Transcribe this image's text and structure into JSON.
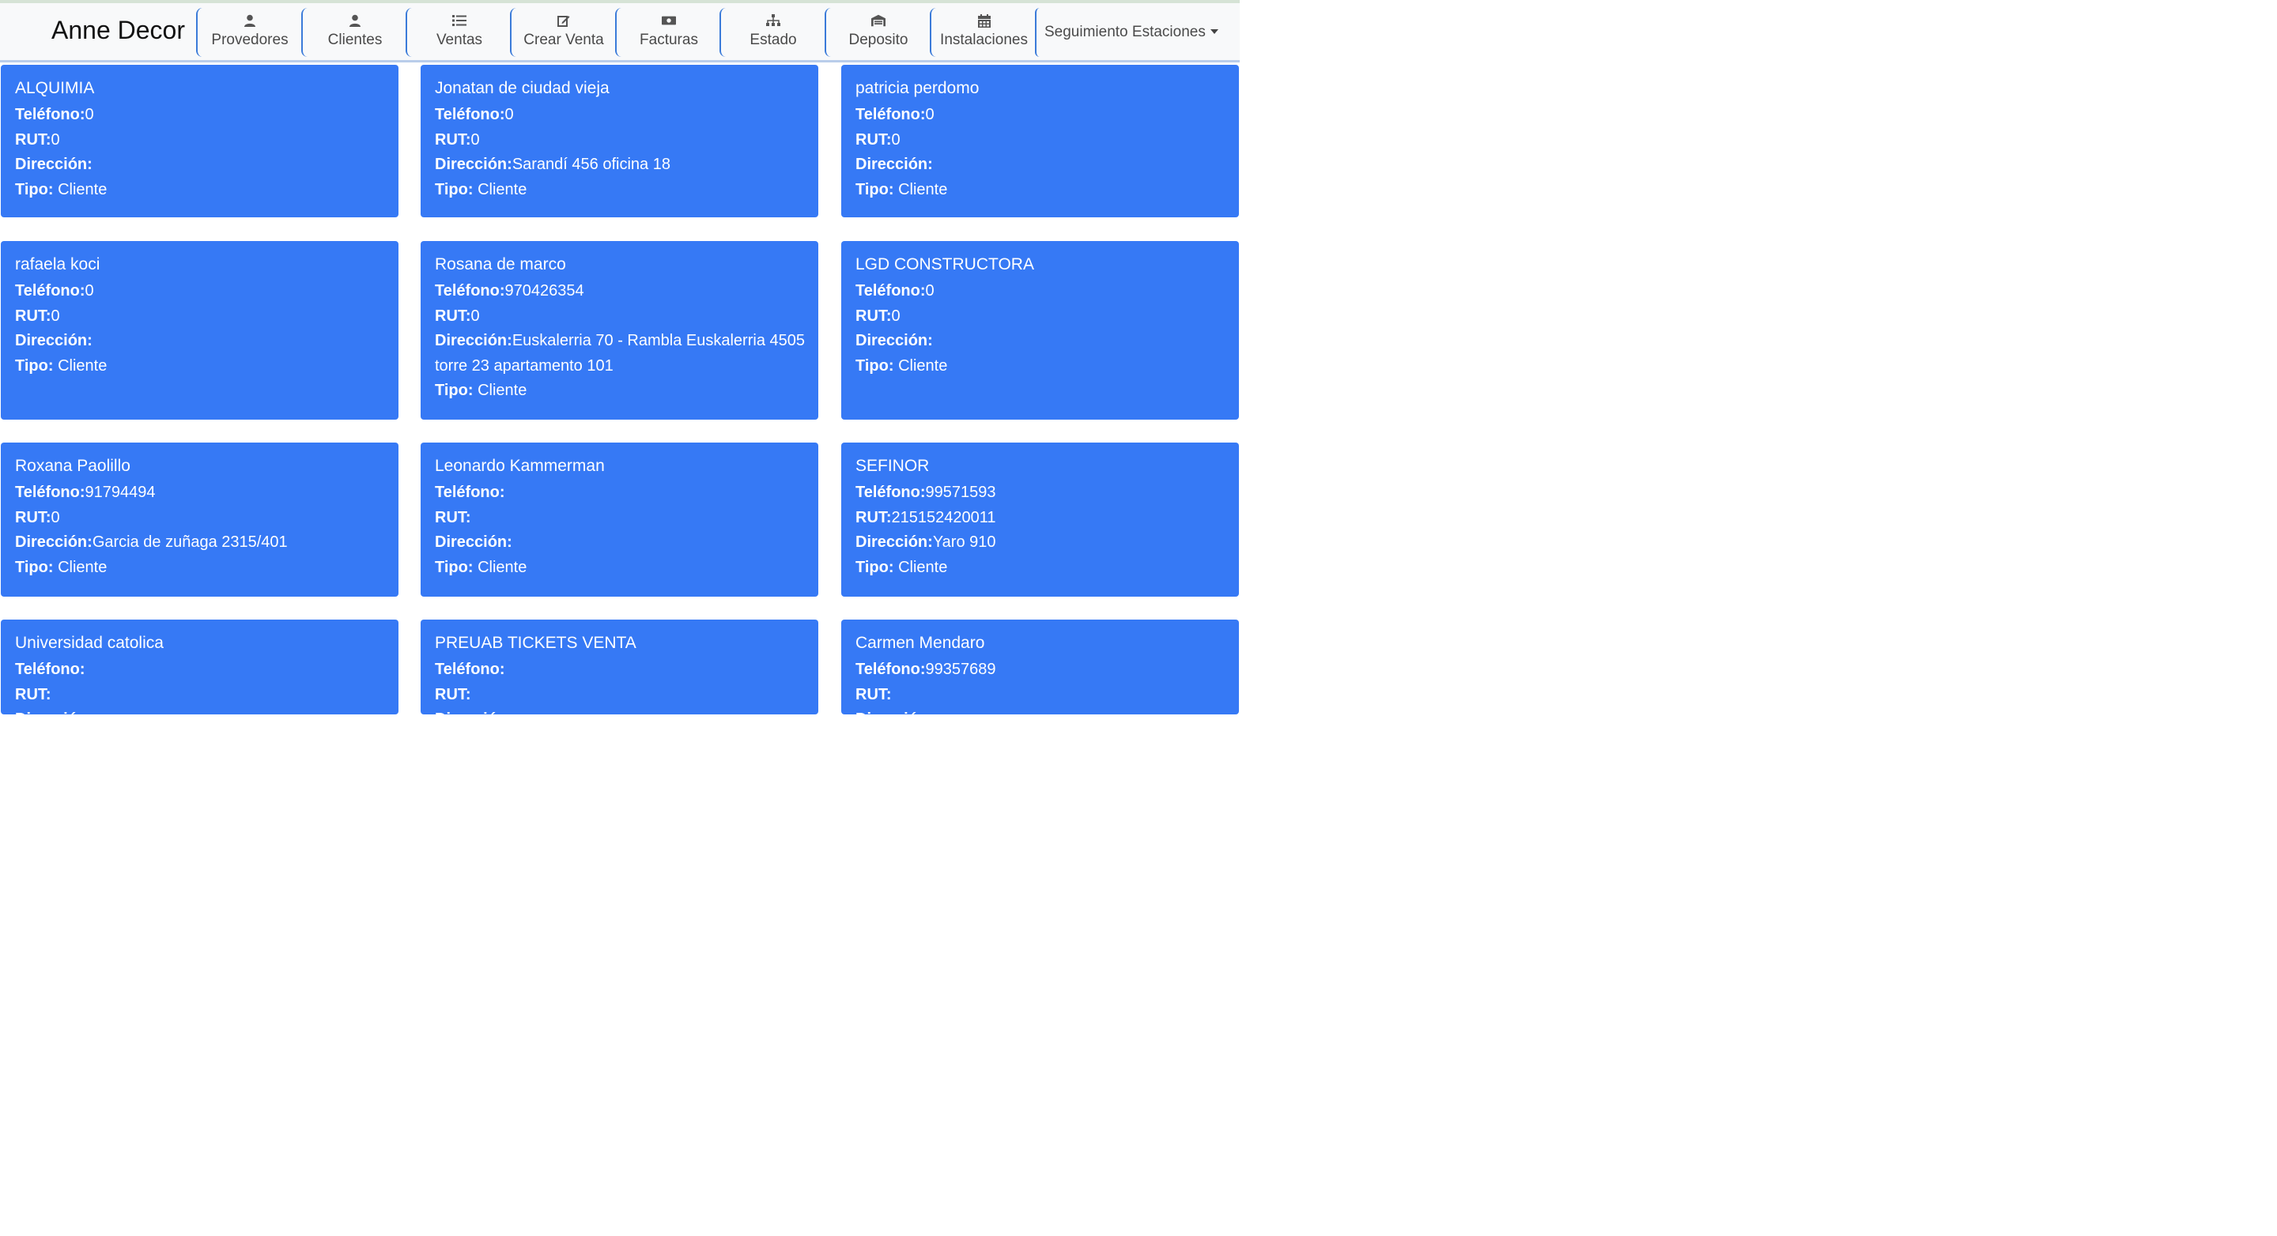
{
  "app": {
    "brand": "Anne Decor"
  },
  "nav": {
    "items": [
      {
        "label": "Provedores",
        "icon": "user-icon"
      },
      {
        "label": "Clientes",
        "icon": "user-icon"
      },
      {
        "label": "Ventas",
        "icon": "list-icon"
      },
      {
        "label": "Crear Venta",
        "icon": "edit-icon"
      },
      {
        "label": "Facturas",
        "icon": "money-bill-icon"
      },
      {
        "label": "Estado",
        "icon": "sitemap-icon"
      },
      {
        "label": "Deposito",
        "icon": "warehouse-icon"
      },
      {
        "label": "Instalaciones",
        "icon": "calendar-icon"
      }
    ],
    "dropdown": {
      "label": "Seguimiento Estaciones"
    }
  },
  "field_labels": {
    "telefono": "Teléfono:",
    "rut": "RUT:",
    "direccion": "Dirección:",
    "tipo": "Tipo:"
  },
  "cards": [
    {
      "name": "ALQUIMIA",
      "telefono": "0",
      "rut": "0",
      "direccion": "",
      "tipo": "Cliente"
    },
    {
      "name": "Jonatan de ciudad vieja",
      "telefono": "0",
      "rut": "0",
      "direccion": "Sarandí 456 oficina 18",
      "tipo": "Cliente"
    },
    {
      "name": "patricia perdomo",
      "telefono": "0",
      "rut": "0",
      "direccion": "",
      "tipo": "Cliente"
    },
    {
      "name": "rafaela koci",
      "telefono": "0",
      "rut": "0",
      "direccion": "",
      "tipo": "Cliente"
    },
    {
      "name": "Rosana de marco",
      "telefono": "970426354",
      "rut": "0",
      "direccion": "Euskalerria 70 - Rambla Euskalerria 4505 torre 23 apartamento 101",
      "tipo": "Cliente"
    },
    {
      "name": "LGD CONSTRUCTORA",
      "telefono": "0",
      "rut": "0",
      "direccion": "",
      "tipo": "Cliente"
    },
    {
      "name": "Roxana Paolillo",
      "telefono": "91794494",
      "rut": "0",
      "direccion": "Garcia de zuñaga 2315/401",
      "tipo": "Cliente"
    },
    {
      "name": "Leonardo Kammerman",
      "telefono": "",
      "rut": "",
      "direccion": "",
      "tipo": "Cliente"
    },
    {
      "name": "SEFINOR",
      "telefono": "99571593",
      "rut": "215152420011",
      "direccion": "Yaro 910",
      "tipo": "Cliente"
    },
    {
      "name": "Universidad catolica",
      "telefono": "",
      "rut": "",
      "direccion": "",
      "tipo": ""
    },
    {
      "name": "PREUAB TICKETS VENTA",
      "telefono": "",
      "rut": "",
      "direccion": "",
      "tipo": ""
    },
    {
      "name": "Carmen Mendaro",
      "telefono": "99357689",
      "rut": "",
      "direccion": "",
      "tipo": ""
    }
  ]
}
